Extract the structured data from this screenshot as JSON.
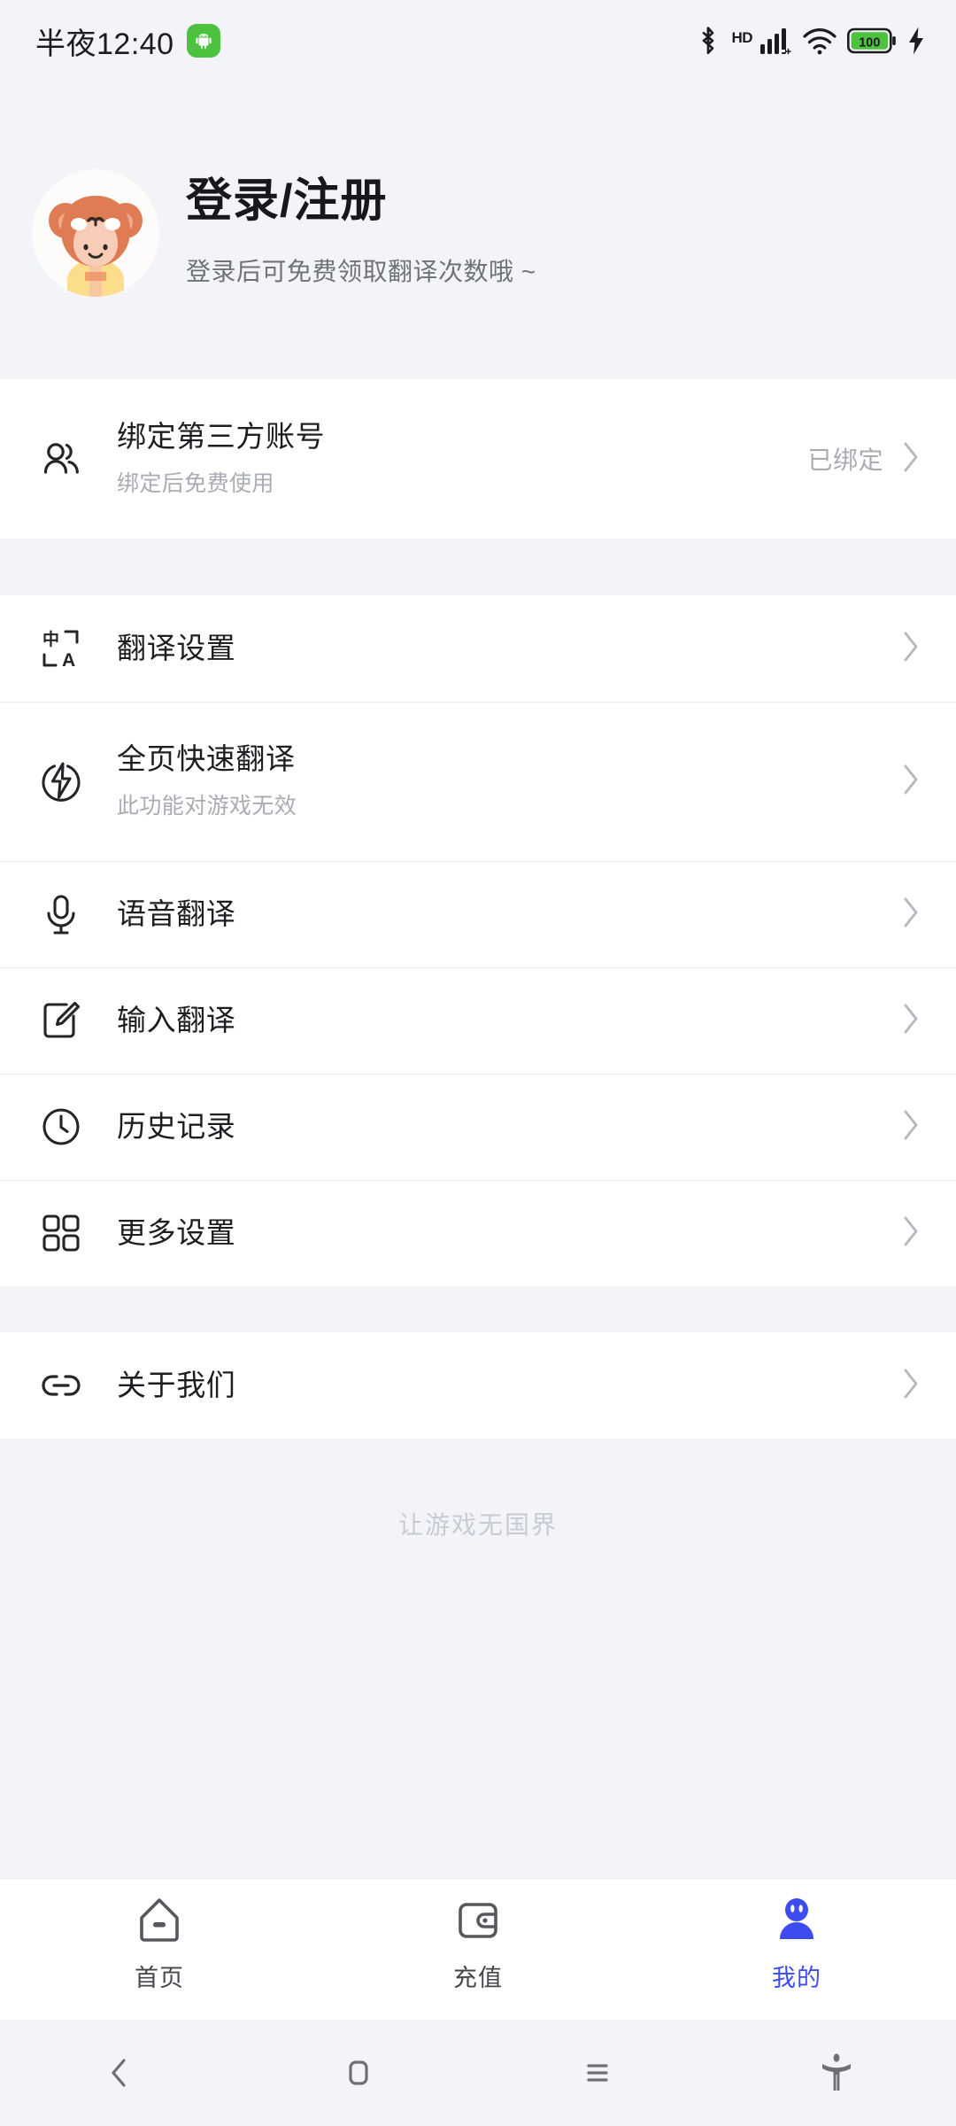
{
  "status_bar": {
    "time": "半夜12:40",
    "android_badge_icon": "android-robot-icon",
    "icons": [
      "bluetooth-icon",
      "hd-icon",
      "cellular-signal-icon",
      "wifi-icon",
      "battery-icon",
      "charging-bolt-icon"
    ],
    "hd_label": "HD",
    "battery_level": "100"
  },
  "header": {
    "avatar_icon": "bear-costume-avatar",
    "title": "登录/注册",
    "subtitle": "登录后可免费领取翻译次数哦 ~"
  },
  "sections": [
    {
      "rows": [
        {
          "icon": "two-people-icon",
          "title": "绑定第三方账号",
          "subtitle": "绑定后免费使用",
          "value": "已绑定",
          "chevron": "chevron-right-icon"
        }
      ]
    },
    {
      "rows": [
        {
          "icon": "translate-icon",
          "title": "翻译设置",
          "subtitle": "",
          "value": "",
          "chevron": "chevron-right-icon"
        },
        {
          "icon": "lightning-circle-icon",
          "title": "全页快速翻译",
          "subtitle": "此功能对游戏无效",
          "value": "",
          "chevron": "chevron-right-icon"
        },
        {
          "icon": "microphone-icon",
          "title": "语音翻译",
          "subtitle": "",
          "value": "",
          "chevron": "chevron-right-icon"
        },
        {
          "icon": "edit-square-icon",
          "title": "输入翻译",
          "subtitle": "",
          "value": "",
          "chevron": "chevron-right-icon"
        },
        {
          "icon": "clock-icon",
          "title": "历史记录",
          "subtitle": "",
          "value": "",
          "chevron": "chevron-right-icon"
        },
        {
          "icon": "grid-squares-icon",
          "title": "更多设置",
          "subtitle": "",
          "value": "",
          "chevron": "chevron-right-icon"
        }
      ]
    },
    {
      "rows": [
        {
          "icon": "link-chain-icon",
          "title": "关于我们",
          "subtitle": "",
          "value": "",
          "chevron": "chevron-right-icon"
        }
      ]
    }
  ],
  "footer": {
    "tagline": "让游戏无国界"
  },
  "tabbar": {
    "active_color": "#3d4cf0",
    "inactive_color": "#56585e",
    "tabs": [
      {
        "icon": "home-icon",
        "label": "首页",
        "active": false
      },
      {
        "icon": "wallet-icon",
        "label": "充值",
        "active": false
      },
      {
        "icon": "person-icon",
        "label": "我的",
        "active": true
      }
    ]
  },
  "system_nav": {
    "buttons": [
      "back-icon",
      "home-square-icon",
      "recents-icon",
      "accessibility-icon"
    ]
  }
}
